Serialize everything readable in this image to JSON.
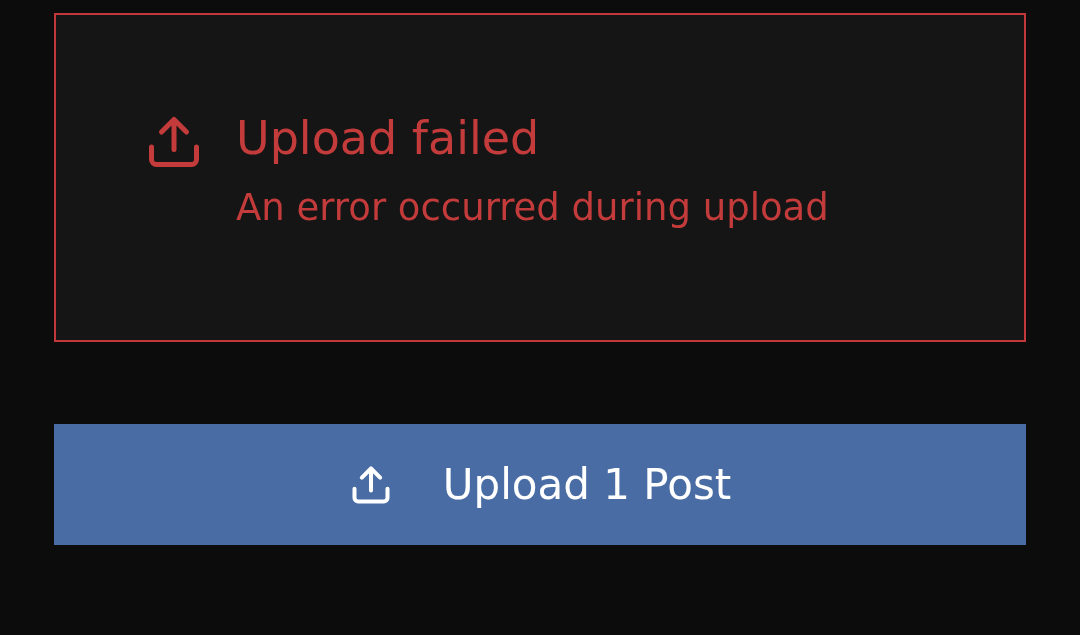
{
  "error_card": {
    "title": "Upload failed",
    "message": "An error occurred during upload"
  },
  "upload_button": {
    "label": "Upload 1 Post"
  }
}
